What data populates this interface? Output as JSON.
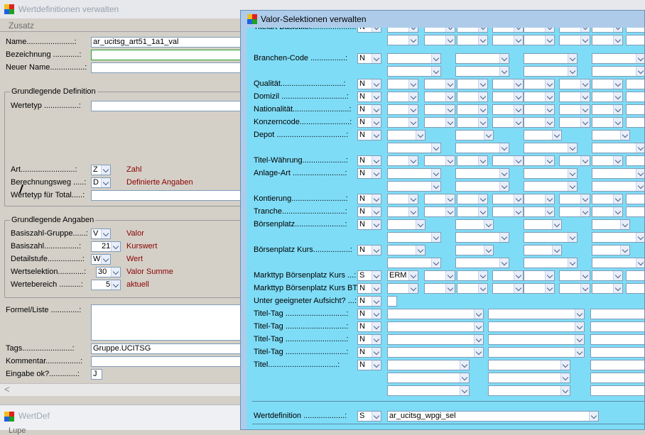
{
  "win1": {
    "title": "Wertdefinitionen verwalten",
    "menu": "Zusatz",
    "fields": {
      "name_label": "Name......................:",
      "name_value": "ar_ucitsg_art51_1a1_val",
      "bez_label": "Bezeichnung ............:",
      "neu_label": "Neuer Name................:",
      "grp1_title": "Grundlegende Definition",
      "wertetyp_label": "Wertetyp ................:",
      "art_label": "Art.........................:",
      "art_value": "Z",
      "art_text": "Zahl",
      "bw_label": "Berechnungsweg .....:",
      "bw_value": "D",
      "bw_text": "Definierte Angaben",
      "wtt_label": "Wertetyp für Total.....:",
      "grp2_title": "Grundlegende Angaben",
      "bzg_label": "Basiszahl-Gruppe......:",
      "bzg_value": "V",
      "bzg_text": "Valor",
      "bz_label": "Basiszahl................:",
      "bz_value": "21",
      "bz_text": "Kurswert",
      "ds_label": "Detailstufe................:",
      "ds_value": "W",
      "ds_text": "Wert",
      "ws_label": "Wertselektion............:",
      "ws_value": "30",
      "ws_text": "Valor Summe",
      "wb_label": "Wertebereich ..........:",
      "wb_value": "5",
      "wb_text": "aktuell",
      "formel_label": "Formel/Liste .............:",
      "tags_label": "Tags.......................:",
      "tags_value": "Gruppe.UCITSG",
      "komm_label": "Kommentar................:",
      "ein_label": "Eingabe ok?.............:",
      "ein_value": "J",
      "scroll": "<"
    }
  },
  "win3": {
    "title": "WertDef",
    "menu": "Lupe"
  },
  "win2": {
    "title": "Valor-Selektionen verwalten",
    "rows": [
      {
        "label": "Titelart Basistitel....................:",
        "v": "N"
      },
      {
        "label": "Branchen-Code ................:",
        "v": "N"
      },
      {
        "label": "Qualität.............................:",
        "v": "N"
      },
      {
        "label": "Domizil ..............................:",
        "v": "N"
      },
      {
        "label": "Nationalität..........................:",
        "v": "N"
      },
      {
        "label": "Konzerncode.......................:",
        "v": "N"
      },
      {
        "label": "Depot ................................:",
        "v": "N"
      },
      {
        "label": "Titel-Währung....................:",
        "v": "N"
      },
      {
        "label": "Anlage-Art ........................:",
        "v": "N"
      },
      {
        "label": "Kontierung.........................:",
        "v": "N"
      },
      {
        "label": "Tranche.............................:",
        "v": "N"
      },
      {
        "label": "Börsenplatz.......................:",
        "v": "N"
      },
      {
        "label": "Börsenplatz Kurs.................:",
        "v": "N"
      },
      {
        "label": "Markttyp Börsenplatz Kurs ...:",
        "v": "S",
        "v2": "ERM"
      },
      {
        "label": "Markttyp Börsenplatz Kurs BT:",
        "v": "N"
      },
      {
        "label": "Unter geeigneter Aufsicht? ...:",
        "v": "N"
      },
      {
        "label": "Titel-Tag ............................:",
        "v": "N"
      },
      {
        "label": "Titel-Tag ............................:",
        "v": "N"
      },
      {
        "label": "Titel-Tag ............................:",
        "v": "N"
      },
      {
        "label": "Titel-Tag ............................:",
        "v": "N"
      },
      {
        "label": "Titel................................:",
        "v": "N"
      },
      {
        "label": "Wertdefinition ...................:",
        "v": "S",
        "v2": "ar_ucitsg_wpgi_sel"
      }
    ]
  }
}
